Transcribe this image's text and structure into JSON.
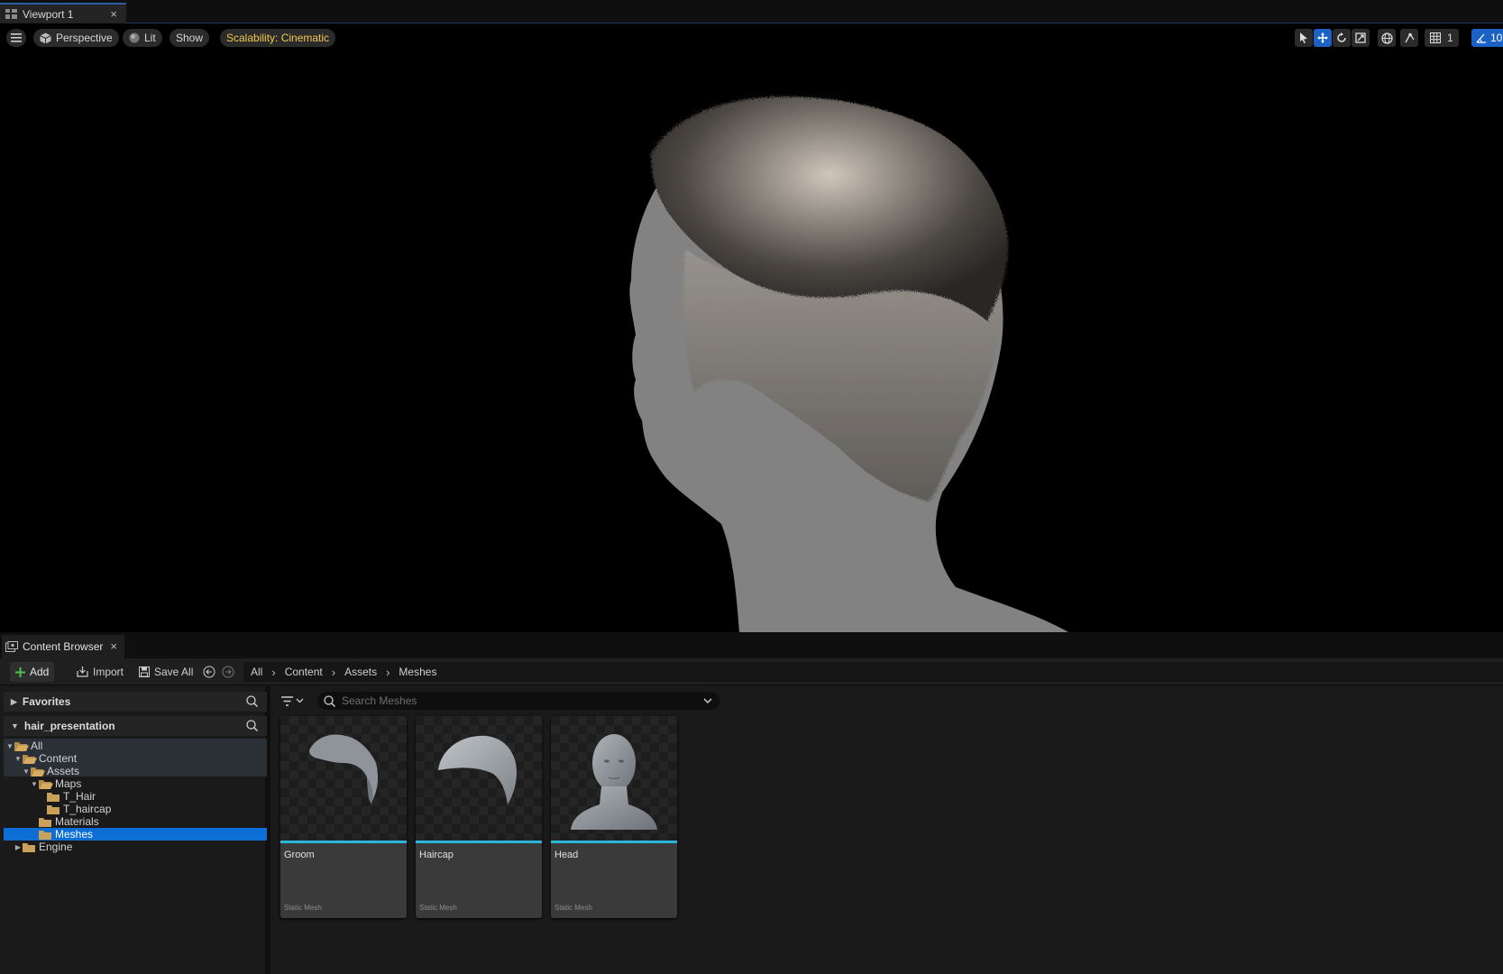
{
  "viewport_tab": {
    "title": "Viewport 1",
    "close": "×"
  },
  "viewport_toolbar": {
    "perspective": "Perspective",
    "lit": "Lit",
    "show": "Show",
    "scalability": "Scalability: Cinematic",
    "grid_value": "1",
    "angle_value": "10"
  },
  "content_browser": {
    "tab_title": "Content Browser",
    "close": "×",
    "toolbar": {
      "add": "Add",
      "import": "Import",
      "save_all": "Save All"
    },
    "breadcrumb": [
      "All",
      "Content",
      "Assets",
      "Meshes"
    ],
    "favorites": "Favorites",
    "project": "hair_presentation",
    "tree": [
      {
        "label": "All",
        "depth": 0,
        "expanded": true
      },
      {
        "label": "Content",
        "depth": 1,
        "expanded": true
      },
      {
        "label": "Assets",
        "depth": 2,
        "expanded": true
      },
      {
        "label": "Maps",
        "depth": 3,
        "expanded": true
      },
      {
        "label": "T_Hair",
        "depth": 4
      },
      {
        "label": "T_haircap",
        "depth": 4
      },
      {
        "label": "Materials",
        "depth": 3
      },
      {
        "label": "Meshes",
        "depth": 3,
        "selected": true
      },
      {
        "label": "Engine",
        "depth": 1,
        "expanded": false
      }
    ],
    "search_placeholder": "Search Meshes",
    "assets": [
      {
        "name": "Groom",
        "type": "Static Mesh"
      },
      {
        "name": "Haircap",
        "type": "Static Mesh"
      },
      {
        "name": "Head",
        "type": "Static Mesh"
      }
    ]
  },
  "colors": {
    "accent": "#0d6fd6",
    "asset_bar": "#29b6d8",
    "scalability_text": "#f2c84b",
    "folder": "#c9a15a"
  }
}
